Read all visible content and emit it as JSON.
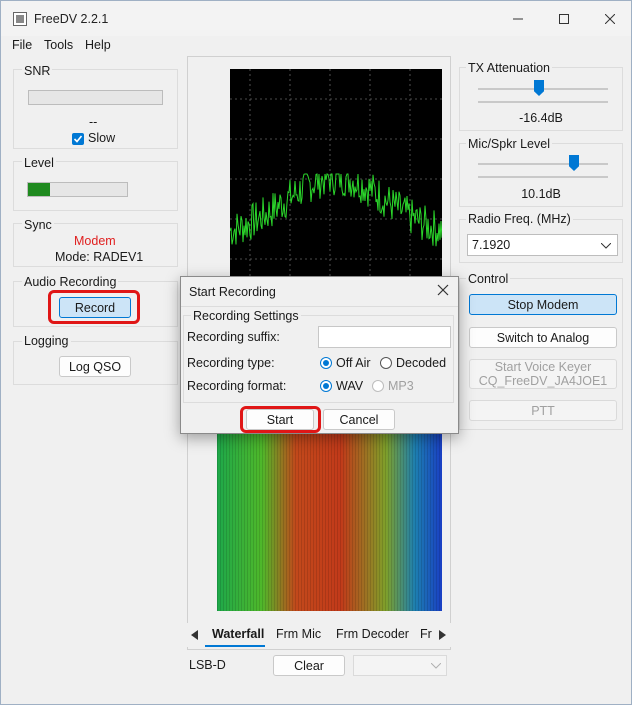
{
  "window": {
    "title": "FreeDV 2.2.1"
  },
  "menu": {
    "file": "File",
    "tools": "Tools",
    "help": "Help"
  },
  "left": {
    "snr": {
      "label": "SNR",
      "value": "--",
      "slow_label": "Slow",
      "slow_checked": true
    },
    "level": {
      "label": "Level",
      "fill_fraction": 0.22
    },
    "sync": {
      "label": "Sync",
      "status": "Modem",
      "mode": "Mode: RADEV1"
    },
    "audio_recording": {
      "label": "Audio Recording",
      "record_button": "Record"
    },
    "logging": {
      "label": "Logging",
      "log_button": "Log QSO"
    }
  },
  "center": {
    "tabs": [
      "Waterfall",
      "Frm Mic",
      "Frm Decoder",
      "Fr"
    ],
    "active_tab": "Waterfall",
    "mode_label": "LSB-D",
    "clear_button": "Clear"
  },
  "right": {
    "tx_attenuation": {
      "label": "TX Attenuation",
      "value": "-16.4dB",
      "slider_fraction": 0.47
    },
    "mic_spkr": {
      "label": "Mic/Spkr Level",
      "value": "10.1dB",
      "slider_fraction": 0.74
    },
    "radio_freq": {
      "label": "Radio Freq. (MHz)",
      "value": "7.1920"
    },
    "control": {
      "label": "Control",
      "stop_modem": "Stop Modem",
      "switch_analog": "Switch to Analog",
      "voice_keyer": "Start Voice Keyer\nCQ_FreeDV_JA4JOE1",
      "ptt": "PTT"
    }
  },
  "dialog": {
    "title": "Start Recording",
    "group_label": "Recording Settings",
    "suffix_label": "Recording suffix:",
    "suffix_value": "",
    "type_label": "Recording type:",
    "type_options": [
      "Off Air",
      "Decoded"
    ],
    "type_selected": "Off Air",
    "format_label": "Recording format:",
    "format_options": [
      "WAV",
      "MP3"
    ],
    "format_selected": "WAV",
    "start_button": "Start",
    "cancel_button": "Cancel"
  },
  "colors": {
    "accent": "#0078d4",
    "highlight": "#e01616",
    "sync_status": "#e02020",
    "level_fill": "#1f8a1f",
    "spectrum": "#2bd62b"
  }
}
